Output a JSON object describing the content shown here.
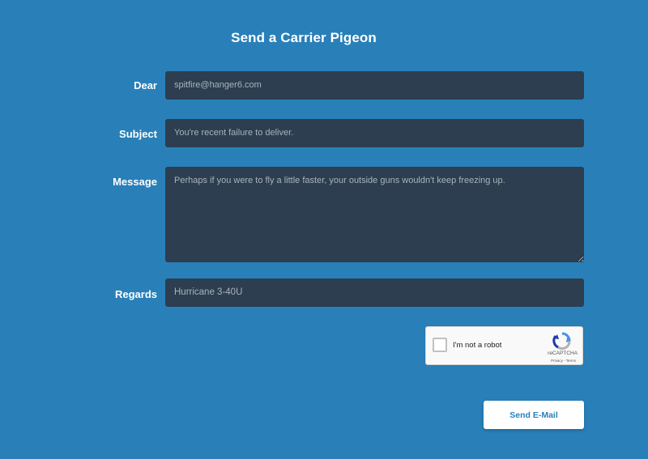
{
  "form": {
    "title": "Send a Carrier Pigeon",
    "fields": {
      "dear": {
        "label": "Dear",
        "value": "spitfire@hanger6.com"
      },
      "subject": {
        "label": "Subject",
        "value": "You're recent failure to deliver."
      },
      "message": {
        "label": "Message",
        "value": "Perhaps if you were to fly a little faster, your outside guns wouldn't keep freezing up."
      },
      "regards": {
        "label": "Regards",
        "value": "Hurricane 3-40U"
      }
    },
    "captcha": {
      "label": "I'm not a robot",
      "brand": "reCAPTCHA",
      "links": "Privacy - Terms",
      "checked": false
    },
    "submit_label": "Send E-Mail"
  },
  "colors": {
    "background": "#2980b9",
    "field_background": "#2c3e50",
    "button_text": "#2980b9"
  }
}
